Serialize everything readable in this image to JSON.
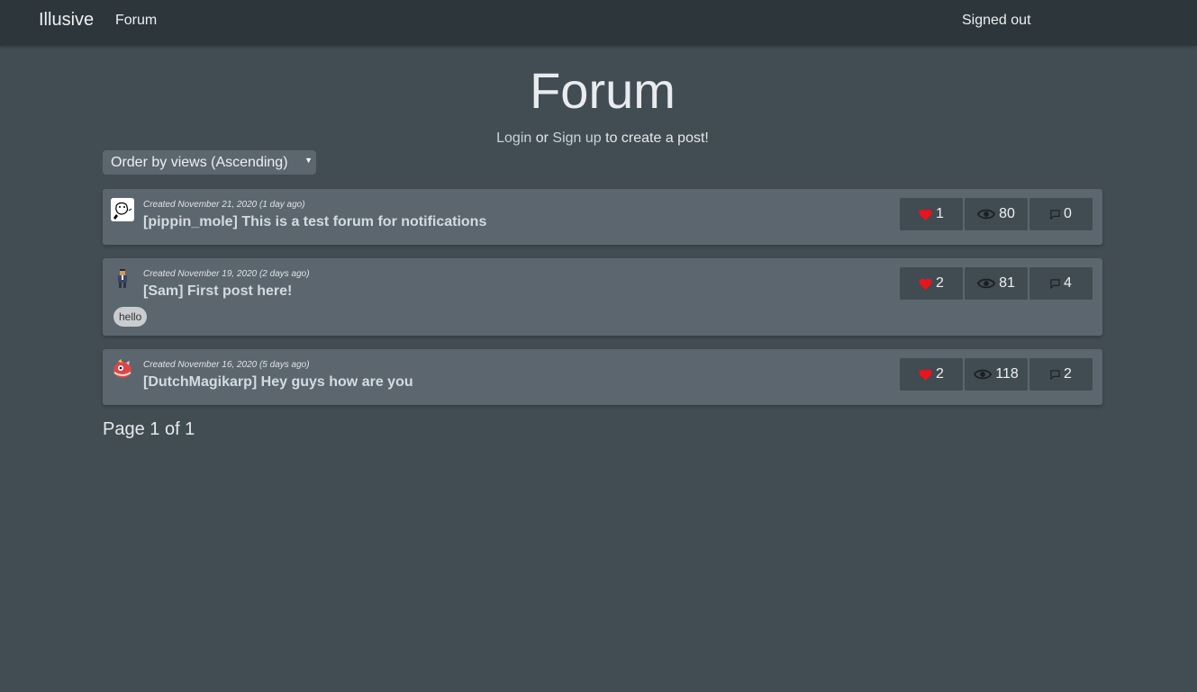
{
  "navbar": {
    "brand": "Illusive",
    "forum_link": "Forum",
    "status": "Signed out"
  },
  "page": {
    "title": "Forum",
    "auth": {
      "login": "Login",
      "or": " or ",
      "signup": "Sign up",
      "suffix": " to create a post!"
    },
    "order_select": {
      "selected": "Order by views (Ascending)"
    }
  },
  "posts": [
    {
      "created": "Created November 21, 2020 (1 day ago)",
      "title": "[pippin_mole] This is a test forum for notifications",
      "likes": "1",
      "views": "80",
      "comments": "0",
      "tags": []
    },
    {
      "created": "Created November 19, 2020 (2 days ago)",
      "title": "[Sam] First post here!",
      "likes": "2",
      "views": "81",
      "comments": "4",
      "tags": [
        "hello"
      ]
    },
    {
      "created": "Created November 16, 2020 (5 days ago)",
      "title": "[DutchMagikarp] Hey guys how are you",
      "likes": "2",
      "views": "118",
      "comments": "2",
      "tags": []
    }
  ],
  "pagination": "Page 1 of 1",
  "icons": {
    "like": "heart-icon",
    "views": "eye-icon",
    "comments": "comment-icon"
  },
  "colors": {
    "background": "#424c53",
    "navbar": "#2d363b",
    "card": "#5b666e",
    "heart": "#e8141e"
  }
}
